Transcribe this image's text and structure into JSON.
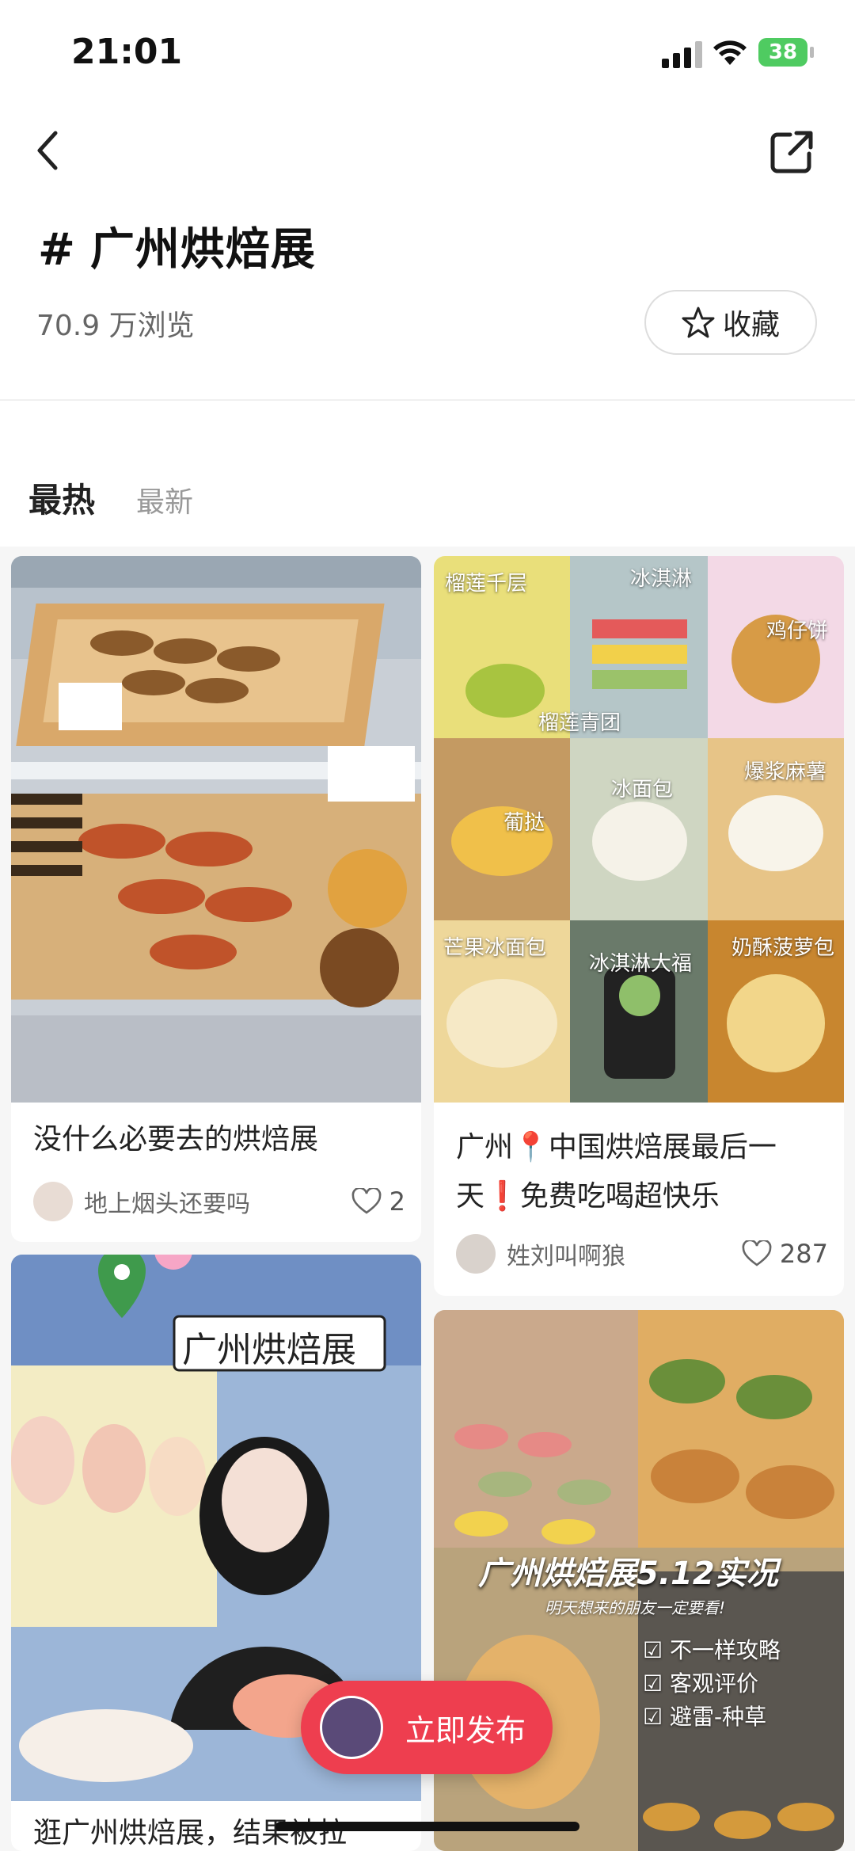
{
  "status_bar": {
    "time": "21:01",
    "battery": "38"
  },
  "topic": {
    "hash": "#",
    "title": "广州烘焙展",
    "views": "70.9 万浏览",
    "favorite_label": "收藏"
  },
  "tabs": [
    {
      "label": "最热"
    },
    {
      "label": "最新"
    }
  ],
  "cards": [
    {
      "title": "没什么必要去的烘焙展",
      "author": "地上烟头还要吗",
      "likes": "2"
    },
    {
      "title_line1": "广州📍中国烘焙展最后一",
      "title_line2": "天❗免费吃喝超快乐",
      "author": "姓刘叫啊狼",
      "likes": "287",
      "image_labels": [
        "榴莲千层",
        "冰淇淋",
        "鸡仔饼",
        "榴莲青团",
        "冰面包",
        "爆浆麻薯",
        "葡挞",
        "芒果冰面包",
        "冰淇淋大福",
        "奶酥菠萝包"
      ]
    },
    {
      "title": "逛广州烘焙展，结果被拉",
      "image_caption": "广州烘焙展"
    },
    {
      "image_caption": "广州烘焙展5.12实况",
      "image_subcaption": "明天想来的朋友一定要看!",
      "checklist": [
        "不一样攻略",
        "客观评价",
        "避雷-种草"
      ]
    }
  ],
  "publish": {
    "label": "立即发布"
  },
  "colors": {
    "accent": "#ee3e4f",
    "battery": "#4fcb61"
  },
  "icons": [
    "signal-icon",
    "wifi-icon",
    "back-icon",
    "share-icon",
    "star-icon",
    "heart-icon"
  ]
}
